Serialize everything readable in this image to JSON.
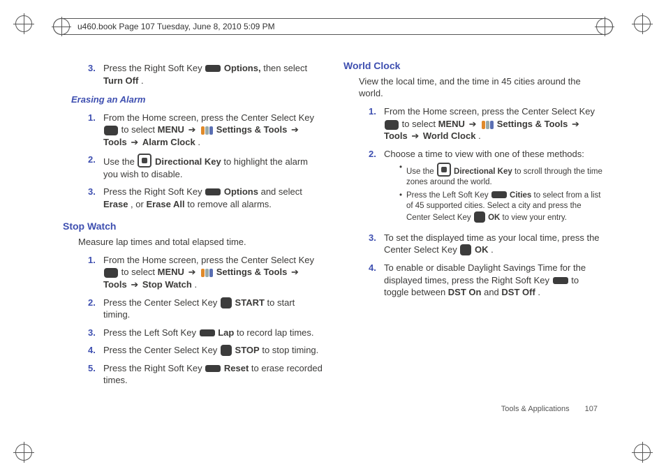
{
  "runhead": "u460.book  Page 107  Tuesday, June 8, 2010  5:09 PM",
  "footer": {
    "section": "Tools & Applications",
    "page": "107"
  },
  "left": {
    "step3_pre": {
      "a": "Press the Right Soft Key ",
      "b": " Options,",
      "c": " then select ",
      "d": "Turn Off",
      "e": "."
    },
    "erasing_h": "Erasing an Alarm",
    "er1": {
      "a": "From the Home screen, press the Center Select Key ",
      "b": " to select ",
      "menu": "MENU",
      "arr": " ➔ ",
      "st": " Settings & Tools",
      "tl": "Tools",
      "item": "Alarm Clock",
      "dot": "."
    },
    "er2": {
      "a": "Use the ",
      "b": " Directional Key",
      "c": " to highlight the alarm you wish to disable."
    },
    "er3": {
      "a": "Press the Right Soft Key ",
      "b": " Options",
      "c": " and select ",
      "d": "Erase",
      "e": ", or ",
      "f": "Erase All",
      "g": " to remove all alarms."
    },
    "stop_h": "Stop Watch",
    "stop_lead": "Measure lap times and total elapsed time.",
    "sw1": {
      "a": "From the Home screen, press the Center Select Key ",
      "b": " to select ",
      "menu": "MENU",
      "arr": " ➔ ",
      "st": " Settings & Tools",
      "tl": "Tools",
      "item": "Stop Watch",
      "dot": "."
    },
    "sw2": {
      "a": "Press the Center Select Key ",
      "b": " START",
      "c": " to start timing."
    },
    "sw3": {
      "a": "Press the Left Soft Key ",
      "b": " Lap",
      "c": " to record lap times."
    },
    "sw4": {
      "a": "Press the Center Select Key ",
      "b": " STOP",
      "c": " to stop timing."
    },
    "sw5": {
      "a": "Press the Right Soft Key ",
      "b": " Reset",
      "c": " to erase recorded times."
    }
  },
  "right": {
    "world_h": "World Clock",
    "world_lead": "View the local time, and the time in 45 cities around the world.",
    "wc1": {
      "a": "From the Home screen, press the Center Select Key ",
      "b": " to select ",
      "menu": "MENU",
      "arr": " ➔ ",
      "st": " Settings & Tools",
      "tl": "Tools",
      "item": "World Clock",
      "dot": "."
    },
    "wc2": {
      "a": "Choose a time to view with one of these methods:"
    },
    "wc2_b1": {
      "a": "Use the ",
      "b": " Directional Key",
      "c": " to scroll through the time zones around the world."
    },
    "wc2_b2": {
      "a": "Press the Left Soft Key ",
      "b": " Cities",
      "c": " to select from a list of 45 supported cities. Select a city and press the Center Select Key ",
      "d": " OK",
      "e": " to view your entry."
    },
    "wc3": {
      "a": "To set the displayed time as your local time, press the Center Select Key ",
      "b": " OK",
      "c": "."
    },
    "wc4": {
      "a": "To enable or disable Daylight Savings Time for the displayed times, press the Right Soft Key ",
      "b": " to toggle between ",
      "c": "DST On",
      "d": " and ",
      "e": "DST Off",
      "f": "."
    }
  }
}
